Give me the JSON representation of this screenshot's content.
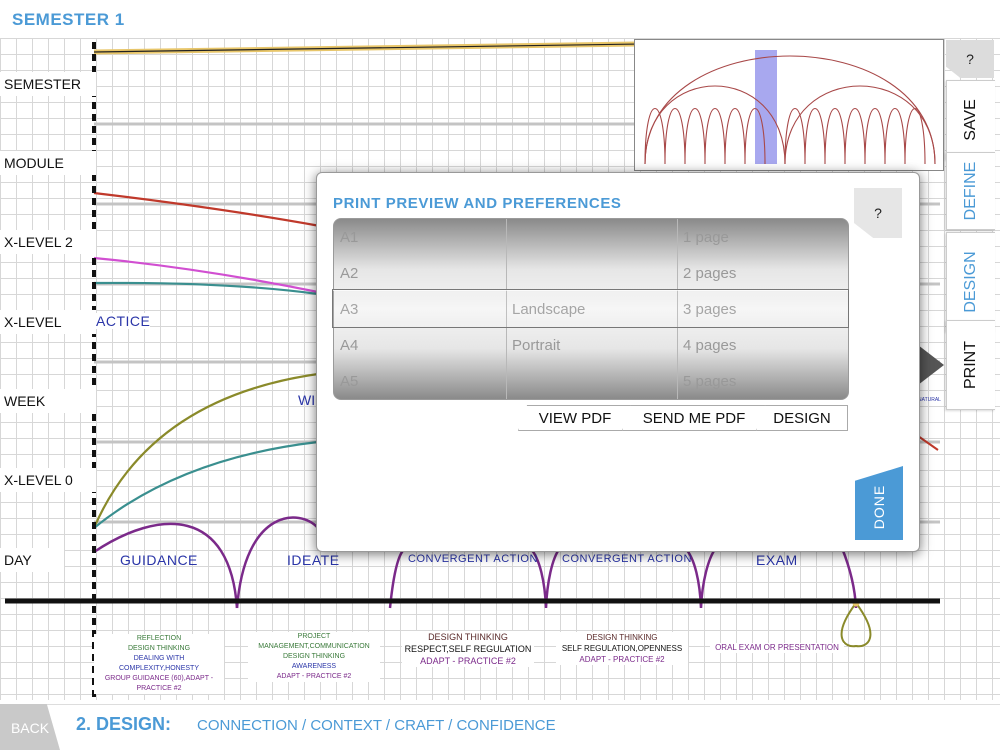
{
  "header": {
    "title": "SEMESTER 1"
  },
  "levels": [
    "SEMESTER",
    "MODULE",
    "X-LEVEL 2",
    "X-LEVEL",
    "WEEK",
    "X-LEVEL 0",
    "DAY"
  ],
  "partial_labels": {
    "practice": "ACTICE",
    "week": "WI",
    "natural": "NATURAL"
  },
  "phases": [
    "GUIDANCE",
    "IDEATE",
    "CONVERGENT ACTION",
    "CONVERGENT ACTION",
    "EXAM"
  ],
  "notes": [
    {
      "lines": [
        "REFLECTION",
        "DESIGN THINKING",
        "DEALING WITH COMPLEXITY,HONESTY",
        "GROUP GUIDANCE (60),ADAPT - PRACTICE #2"
      ]
    },
    {
      "lines": [
        "PROJECT MANAGEMENT,COMMUNICATION",
        "DESIGN THINKING",
        "AWARENESS",
        "ADAPT - PRACTICE #2"
      ]
    },
    {
      "lines": [
        "DESIGN THINKING",
        "RESPECT,SELF REGULATION",
        "ADAPT - PRACTICE #2"
      ]
    },
    {
      "lines": [
        "DESIGN THINKING",
        "SELF REGULATION,OPENNESS",
        "ADAPT - PRACTICE #2"
      ]
    },
    {
      "lines": [
        "ORAL EXAM OR PRESENTATION"
      ]
    }
  ],
  "side_tabs": {
    "help": "?",
    "save": "SAVE",
    "define": "DEFINE",
    "design": "DESIGN",
    "print": "PRINT"
  },
  "dialog": {
    "title": "PRINT PREVIEW AND PREFERENCES",
    "help": "?",
    "picker": {
      "sizes": [
        "A1",
        "A2",
        "A3",
        "A4",
        "A5"
      ],
      "orientation": [
        "",
        "",
        "Landscape",
        "Portrait",
        ""
      ],
      "pages": [
        "1 page",
        "2 pages",
        "3 pages",
        "4 pages",
        "5 pages"
      ],
      "selected_index": 2
    },
    "buttons": {
      "view_pdf": "VIEW PDF",
      "send_pdf": "SEND ME PDF",
      "design": "DESIGN"
    },
    "done": "DONE"
  },
  "footer": {
    "back": "BACK",
    "step": "2. DESIGN:",
    "subtitle": "CONNECTION / CONTEXT / CRAFT / CONFIDENCE"
  },
  "colors": {
    "accent": "#4b9ad6",
    "semester": "#d8b13c",
    "module": "#c0392b",
    "xlevel2": "#d14fd1",
    "xlevel": "#3a8f8f",
    "week": "#8a8a2a",
    "day": "#7b2a8a"
  }
}
